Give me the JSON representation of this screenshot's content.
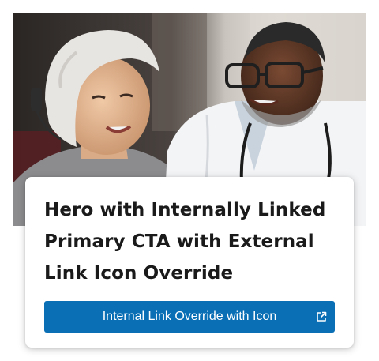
{
  "hero": {
    "image_icon": "photo-of-patient-and-doctor",
    "title": "Hero with Internally Linked Primary CTA with External Link Icon Override",
    "cta": {
      "label": "Internal Link Override with Icon",
      "icon": "external-link-icon"
    }
  },
  "colors": {
    "cta_background": "#0b6fb5",
    "title_text": "#1a1a1a",
    "card_background": "#ffffff"
  }
}
